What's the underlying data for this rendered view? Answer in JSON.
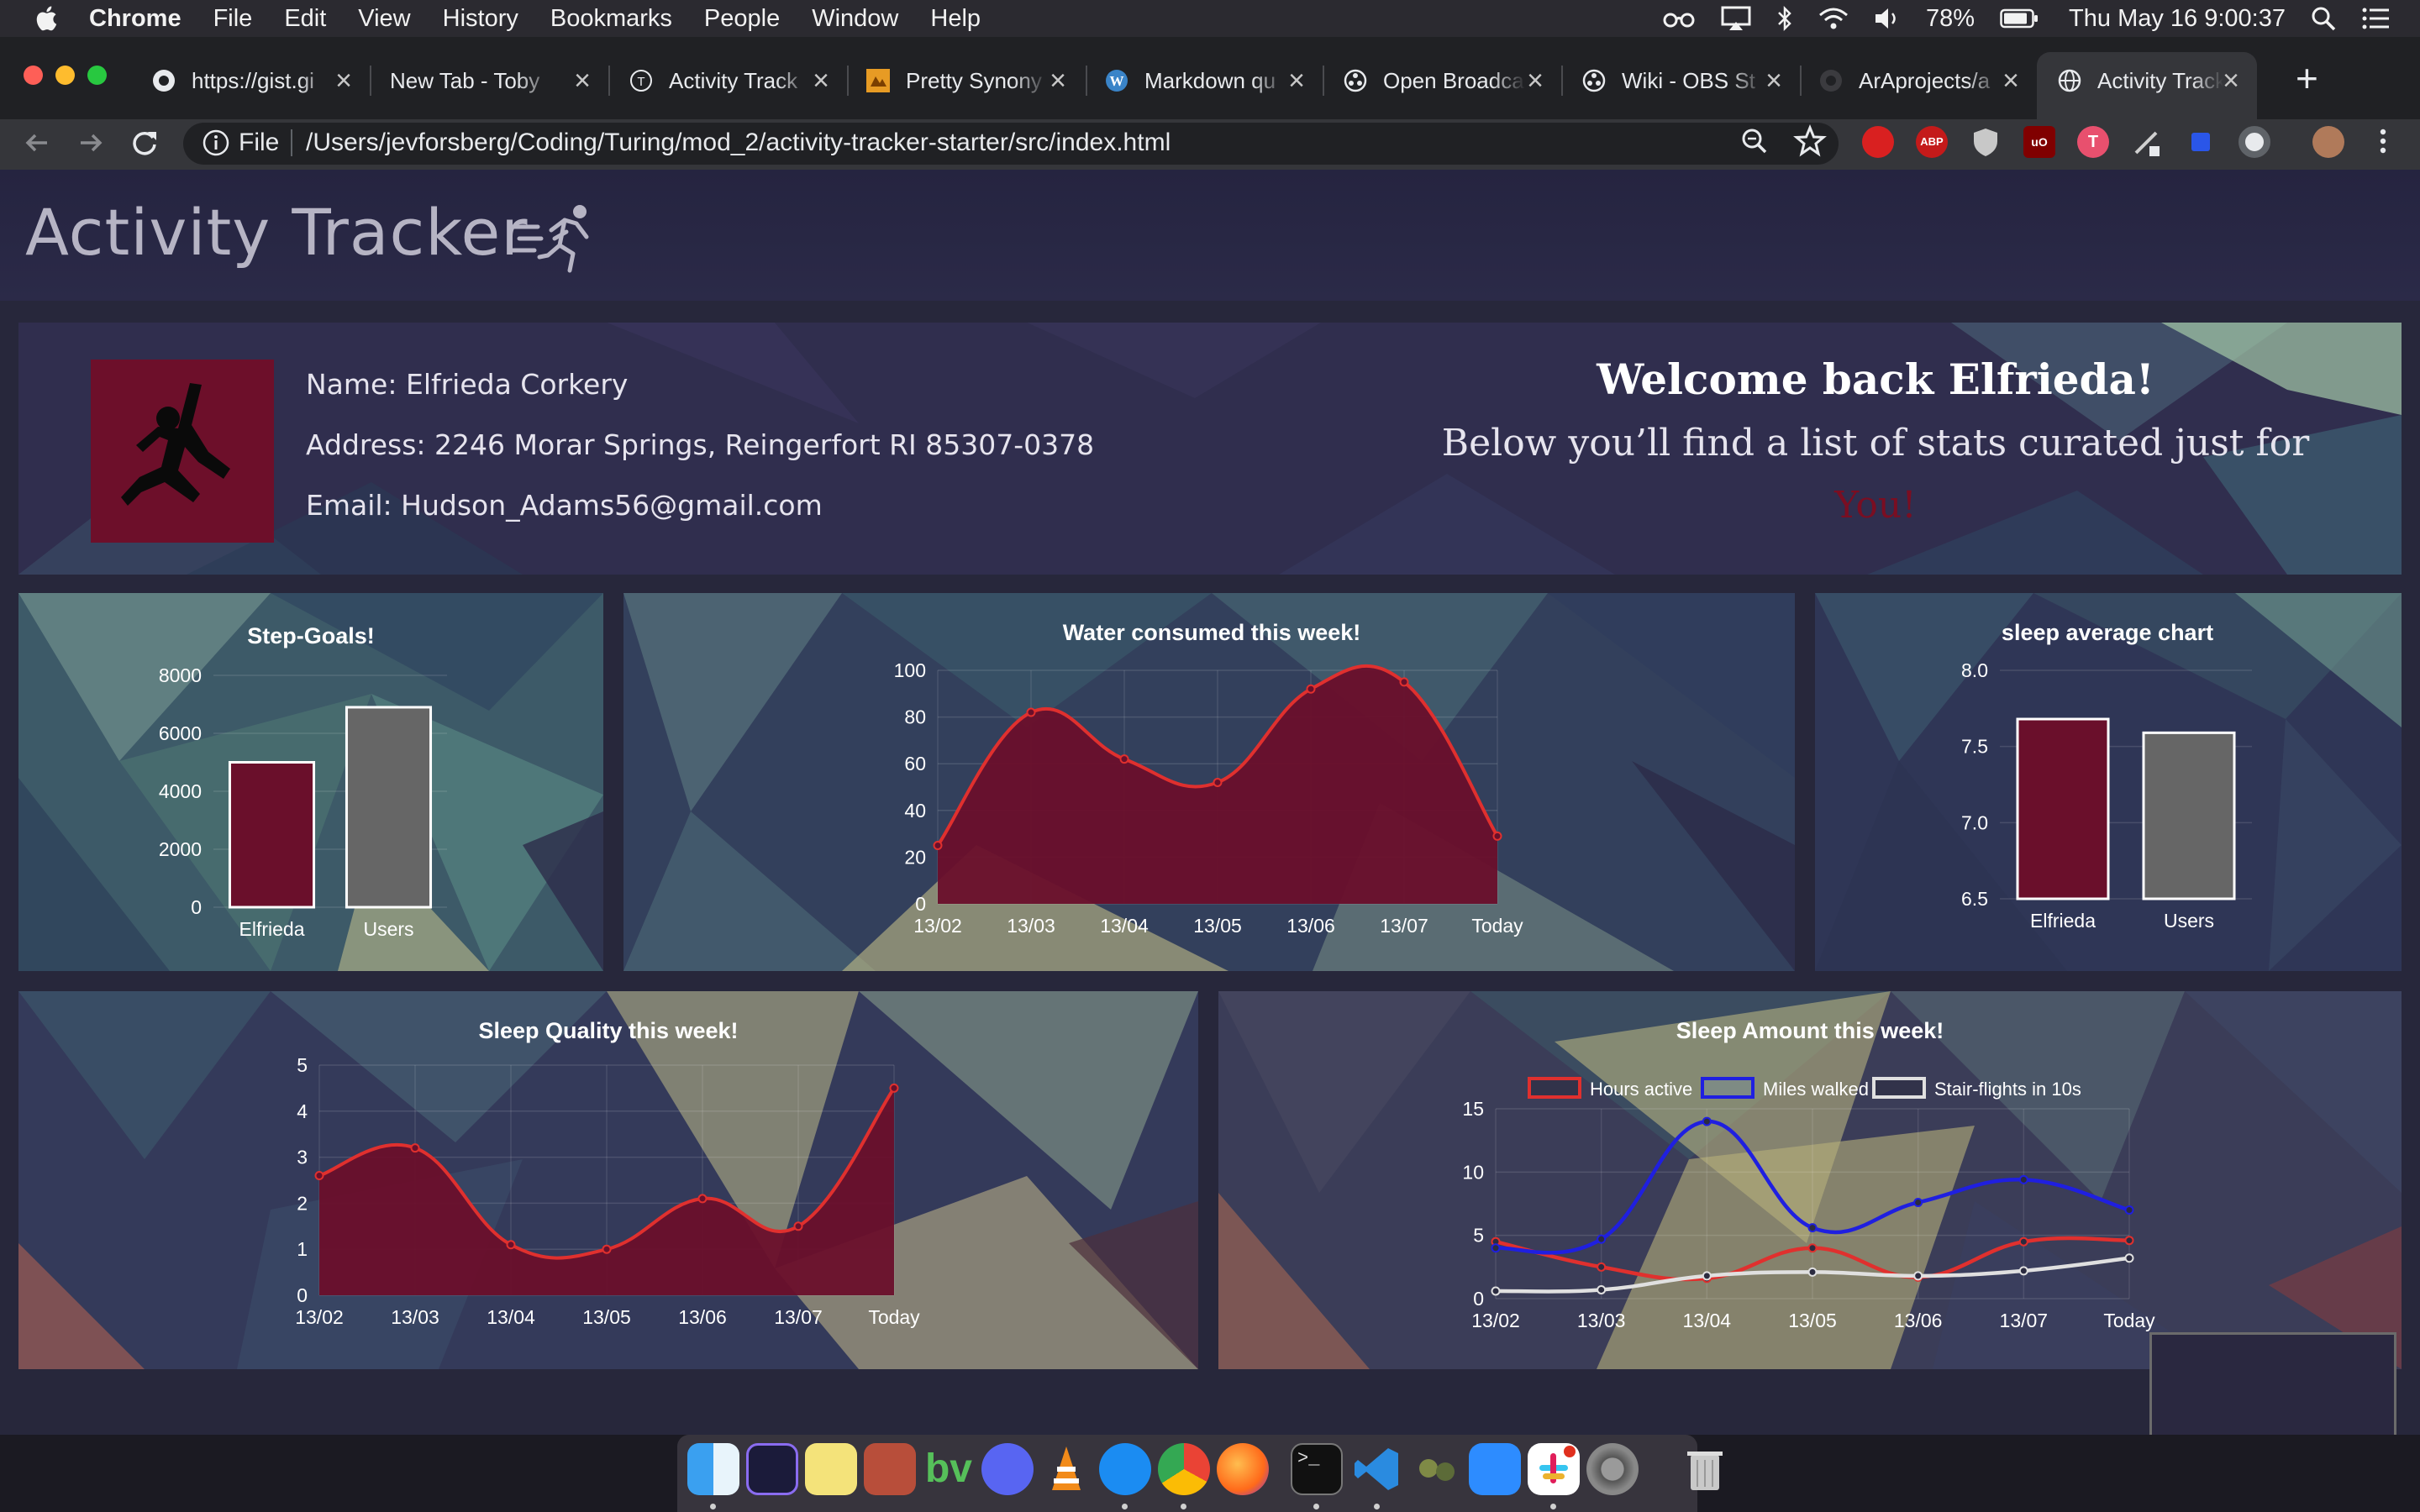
{
  "menubar": {
    "app": "Chrome",
    "items": [
      "File",
      "Edit",
      "View",
      "History",
      "Bookmarks",
      "People",
      "Window",
      "Help"
    ],
    "battery": "78%",
    "clock": "Thu May 16  9:00:37"
  },
  "browser": {
    "tabs": [
      {
        "title": "https://gist.gi",
        "icon": "github-icon"
      },
      {
        "title": "New Tab - Toby",
        "icon": "none"
      },
      {
        "title": "Activity Track",
        "icon": "turing-icon"
      },
      {
        "title": "Pretty Synony",
        "icon": "thesaurus-icon"
      },
      {
        "title": "Markdown qu",
        "icon": "wordpress-icon"
      },
      {
        "title": "Open Broadca",
        "icon": "obs-icon"
      },
      {
        "title": "Wiki - OBS St",
        "icon": "obs-icon"
      },
      {
        "title": "ArAprojects/a",
        "icon": "github-icon"
      },
      {
        "title": "Activity Track",
        "icon": "globe-icon",
        "active": true
      }
    ],
    "url_scheme": "File",
    "url": "/Users/jevforsberg/Coding/Turing/mod_2/activity-tracker-starter/src/index.html"
  },
  "page": {
    "title": "Activity Tracker",
    "user": {
      "name_line": "Name: Elfrieda Corkery",
      "address_line": "Address: 2246 Morar Springs, Reingerfort RI 85307-0378",
      "email_line": "Email: Hudson_Adams56@gmail.com"
    },
    "welcome": {
      "title": "Welcome back Elfrieda!",
      "subtitle": "Below you’ll find a list of stats curated just for",
      "emphasis": "You!"
    }
  },
  "colors": {
    "maroon": "#6a0f2b",
    "gray_bar": "#666666",
    "red_line": "#e0302e",
    "blue_line": "#1f1fe0",
    "white_line": "#e0e0e0",
    "page_bg": "#27273b"
  },
  "chart_data": [
    {
      "type": "bar",
      "title": "Step-Goals!",
      "categories": [
        "Elfrieda",
        "Users"
      ],
      "values": [
        5000,
        6900
      ],
      "ylim": [
        0,
        8000
      ],
      "yticks": [
        0,
        2000,
        4000,
        6000,
        8000
      ]
    },
    {
      "type": "area",
      "title": "Water consumed this week!",
      "categories": [
        "13/02",
        "13/03",
        "13/04",
        "13/05",
        "13/06",
        "13/07",
        "Today"
      ],
      "values": [
        25,
        82,
        62,
        52,
        92,
        95,
        29
      ],
      "ylim": [
        0,
        100
      ],
      "yticks": [
        0,
        20,
        40,
        60,
        80,
        100
      ]
    },
    {
      "type": "bar",
      "title": "sleep average chart",
      "categories": [
        "Elfrieda",
        "Users"
      ],
      "values": [
        7.68,
        7.59
      ],
      "ylim": [
        6.5,
        8.0
      ],
      "yticks": [
        6.5,
        7.0,
        7.5,
        8.0
      ]
    },
    {
      "type": "area",
      "title": "Sleep Quality this week!",
      "categories": [
        "13/02",
        "13/03",
        "13/04",
        "13/05",
        "13/06",
        "13/07",
        "Today"
      ],
      "values": [
        2.6,
        3.2,
        1.1,
        1.0,
        2.1,
        1.5,
        4.5
      ],
      "ylim": [
        0,
        5
      ],
      "yticks": [
        0,
        1,
        2,
        3,
        4,
        5
      ]
    },
    {
      "type": "line",
      "title": "Sleep Amount this week!",
      "categories": [
        "13/02",
        "13/03",
        "13/04",
        "13/05",
        "13/06",
        "13/07",
        "Today"
      ],
      "ylim": [
        0,
        15
      ],
      "yticks": [
        0,
        5,
        10,
        15
      ],
      "legend_position": "top",
      "series": [
        {
          "name": "Hours active",
          "values": [
            4.5,
            2.5,
            1.6,
            4.0,
            1.7,
            4.5,
            4.6
          ]
        },
        {
          "name": "Miles walked",
          "values": [
            4.0,
            4.7,
            14.0,
            5.6,
            7.6,
            9.4,
            7.0
          ]
        },
        {
          "name": "Stair-flights in 10s",
          "values": [
            0.6,
            0.7,
            1.8,
            2.1,
            1.8,
            2.2,
            3.2
          ]
        }
      ]
    }
  ]
}
